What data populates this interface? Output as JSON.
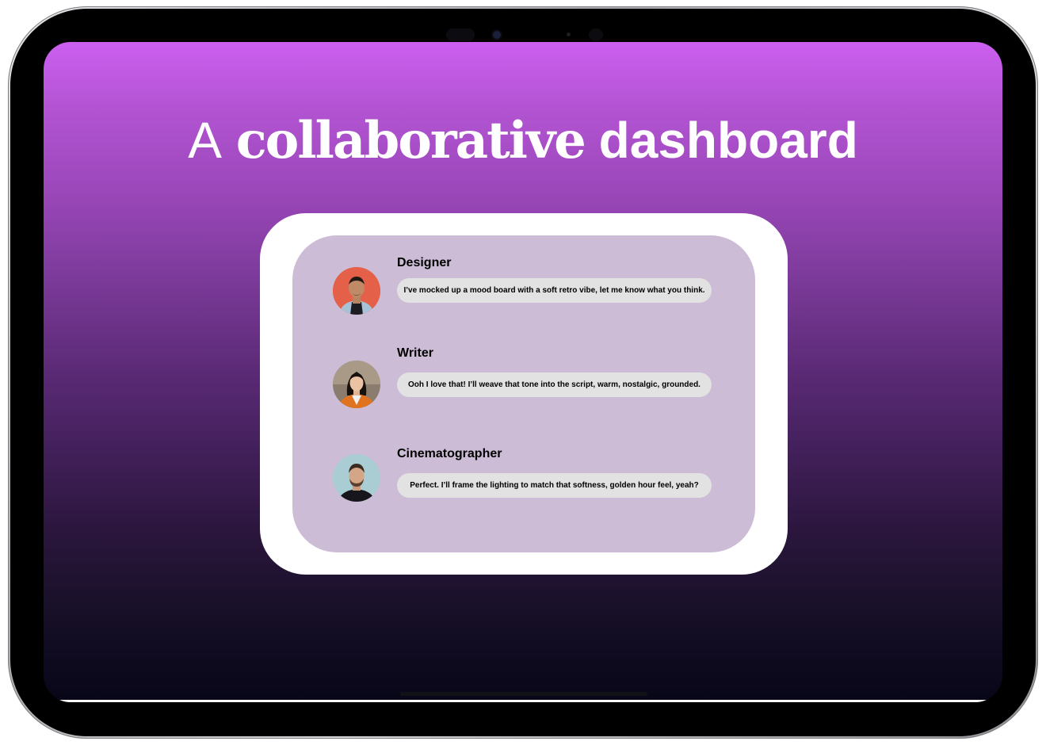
{
  "headline": {
    "word1": "A",
    "word2": "collaborative",
    "word3": "dashboard"
  },
  "messages": [
    {
      "role": "Designer",
      "text": "I’ve mocked up a mood board with a soft retro vibe, let me know what you think.",
      "avatar": "designer-avatar"
    },
    {
      "role": "Writer",
      "text": "Ooh I love that! I’ll weave that tone into the script, warm, nostalgic, grounded.",
      "avatar": "writer-avatar"
    },
    {
      "role": "Cinematographer",
      "text": "Perfect. I’ll frame the lighting to match that softness,  golden hour feel, yeah?",
      "avatar": "cinematographer-avatar"
    }
  ],
  "colors": {
    "gradient_top": "#cc5ff0",
    "gradient_bottom": "#070617",
    "card_inner": "#ccbcd5",
    "bubble": "#e2e2e2"
  }
}
